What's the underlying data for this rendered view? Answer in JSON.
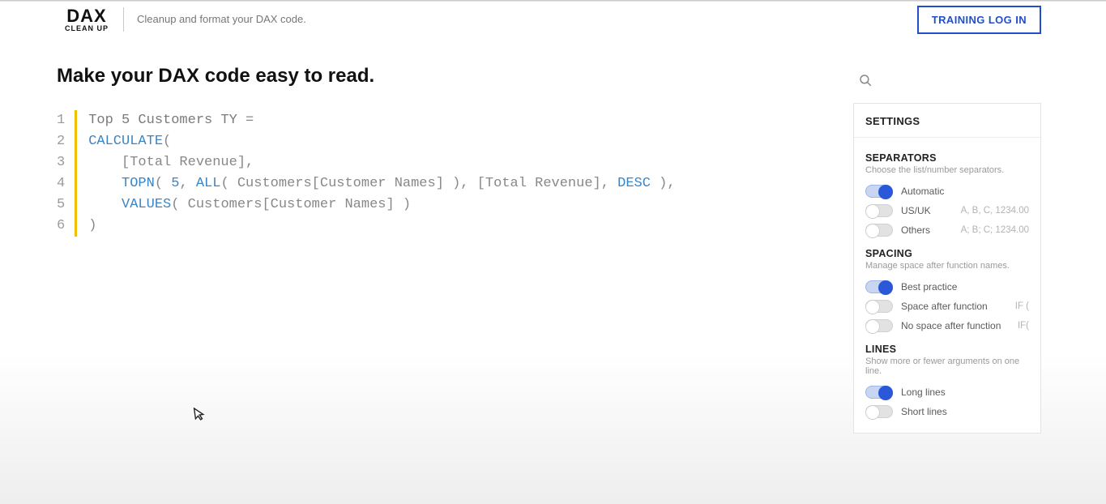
{
  "header": {
    "logo_main": "DAX",
    "logo_sub": "CLEAN UP",
    "tagline": "Cleanup and format your DAX code.",
    "training_btn": "TRAINING LOG IN"
  },
  "page_title": "Make your DAX code easy to read.",
  "code_lines": [
    [
      {
        "cls": "tok-ident",
        "text": "Top 5 Customers TY "
      },
      {
        "cls": "tok-plain",
        "text": "="
      }
    ],
    [
      {
        "cls": "tok-fn",
        "text": "CALCULATE"
      },
      {
        "cls": "tok-plain",
        "text": "("
      }
    ],
    [
      {
        "cls": "tok-plain",
        "text": "    "
      },
      {
        "cls": "tok-bracket",
        "text": "[Total Revenue]"
      },
      {
        "cls": "tok-plain",
        "text": ","
      }
    ],
    [
      {
        "cls": "tok-plain",
        "text": "    "
      },
      {
        "cls": "tok-fn",
        "text": "TOPN"
      },
      {
        "cls": "tok-plain",
        "text": "( "
      },
      {
        "cls": "tok-num",
        "text": "5"
      },
      {
        "cls": "tok-plain",
        "text": ", "
      },
      {
        "cls": "tok-fn",
        "text": "ALL"
      },
      {
        "cls": "tok-plain",
        "text": "( Customers[Customer Names] ), "
      },
      {
        "cls": "tok-bracket",
        "text": "[Total Revenue]"
      },
      {
        "cls": "tok-plain",
        "text": ", "
      },
      {
        "cls": "tok-kw",
        "text": "DESC"
      },
      {
        "cls": "tok-plain",
        "text": " ),"
      }
    ],
    [
      {
        "cls": "tok-plain",
        "text": "    "
      },
      {
        "cls": "tok-fn",
        "text": "VALUES"
      },
      {
        "cls": "tok-plain",
        "text": "( Customers[Customer Names] )"
      }
    ],
    [
      {
        "cls": "tok-plain",
        "text": ")"
      }
    ]
  ],
  "settings": {
    "title": "SETTINGS",
    "sections": [
      {
        "title": "SEPARATORS",
        "sub": "Choose the list/number separators.",
        "options": [
          {
            "label": "Automatic",
            "hint": "",
            "on": true
          },
          {
            "label": "US/UK",
            "hint": "A, B, C, 1234.00",
            "on": false
          },
          {
            "label": "Others",
            "hint": "A; B; C; 1234.00",
            "on": false
          }
        ]
      },
      {
        "title": "SPACING",
        "sub": "Manage space after function names.",
        "options": [
          {
            "label": "Best practice",
            "hint": "",
            "on": true
          },
          {
            "label": "Space after function",
            "hint": "IF (",
            "on": false
          },
          {
            "label": "No space after function",
            "hint": "IF(",
            "on": false
          }
        ]
      },
      {
        "title": "LINES",
        "sub": "Show more or fewer arguments on one line.",
        "options": [
          {
            "label": "Long lines",
            "hint": "",
            "on": true
          },
          {
            "label": "Short lines",
            "hint": "",
            "on": false
          }
        ]
      }
    ]
  }
}
